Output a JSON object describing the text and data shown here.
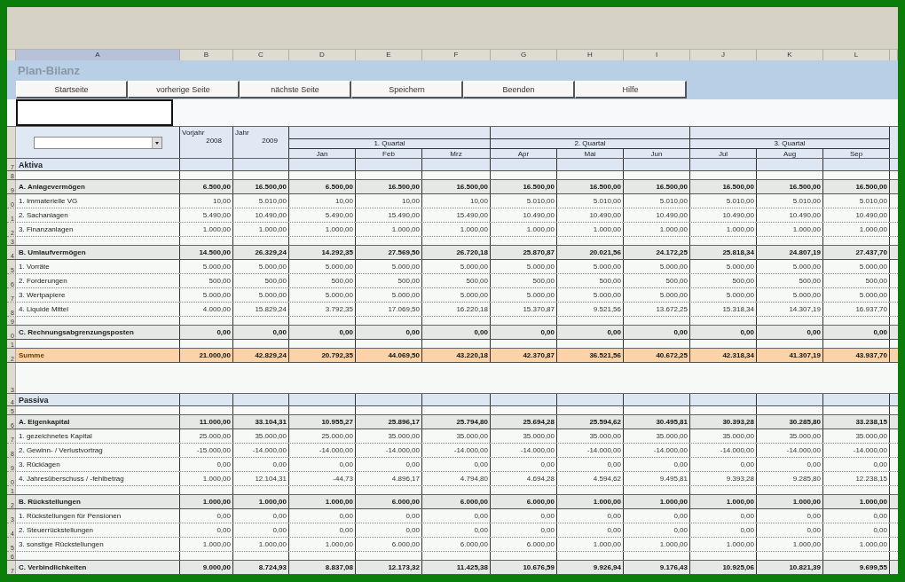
{
  "column_letters": [
    "A",
    "B",
    "C",
    "D",
    "E",
    "F",
    "G",
    "H",
    "I",
    "J",
    "K",
    "L"
  ],
  "title": "Plan-Bilanz",
  "buttons": [
    "Startseite",
    "vorherige Seite",
    "nächste Seite",
    "Speichern",
    "Beenden",
    "Hilfe"
  ],
  "header": {
    "prev_year_label": "Vorjahr",
    "prev_year": "2008",
    "year_label": "Jahr",
    "year": "2009",
    "quarters": [
      "1. Quartal",
      "2. Quartal",
      "3. Quartal"
    ],
    "months": [
      "Jan",
      "Feb",
      "Mrz",
      "Apr",
      "Mai",
      "Jun",
      "Jul",
      "Aug",
      "Sep"
    ]
  },
  "rows": [
    {
      "kind": "section",
      "row_number": "7",
      "label": "Aktiva"
    },
    {
      "kind": "blank",
      "row_number": "8"
    },
    {
      "kind": "group",
      "row_number": "9",
      "label": "A. Anlagevermögen",
      "values": [
        "6.500,00",
        "16.500,00",
        "6.500,00",
        "16.500,00",
        "16.500,00",
        "16.500,00",
        "16.500,00",
        "16.500,00",
        "16.500,00",
        "16.500,00",
        "16.500,00"
      ]
    },
    {
      "kind": "item",
      "row_number": "0",
      "label": "1. Immaterielle VG",
      "values": [
        "10,00",
        "5.010,00",
        "10,00",
        "10,00",
        "10,00",
        "5.010,00",
        "5.010,00",
        "5.010,00",
        "5.010,00",
        "5.010,00",
        "5.010,00"
      ]
    },
    {
      "kind": "item",
      "row_number": "1",
      "label": "2. Sachanlagen",
      "values": [
        "5.490,00",
        "10.490,00",
        "5.490,00",
        "15.490,00",
        "15.490,00",
        "10.490,00",
        "10.490,00",
        "10.490,00",
        "10.490,00",
        "10.490,00",
        "10.490,00"
      ]
    },
    {
      "kind": "item",
      "row_number": "2",
      "label": "3. Finanzanlagen",
      "values": [
        "1.000,00",
        "1.000,00",
        "1.000,00",
        "1.000,00",
        "1.000,00",
        "1.000,00",
        "1.000,00",
        "1.000,00",
        "1.000,00",
        "1.000,00",
        "1.000,00"
      ]
    },
    {
      "kind": "blank",
      "row_number": "3"
    },
    {
      "kind": "group",
      "row_number": "4",
      "label": "B. Umlaufvermögen",
      "values": [
        "14.500,00",
        "26.329,24",
        "14.292,35",
        "27.569,50",
        "26.720,18",
        "25.870,87",
        "20.021,56",
        "24.172,25",
        "25.818,34",
        "24.807,19",
        "27.437,70"
      ]
    },
    {
      "kind": "item",
      "row_number": "5",
      "label": "1. Vorräte",
      "values": [
        "5.000,00",
        "5.000,00",
        "5.000,00",
        "5.000,00",
        "5.000,00",
        "5.000,00",
        "5.000,00",
        "5.000,00",
        "5.000,00",
        "5.000,00",
        "5.000,00"
      ]
    },
    {
      "kind": "item",
      "row_number": "6",
      "label": "2. Forderungen",
      "values": [
        "500,00",
        "500,00",
        "500,00",
        "500,00",
        "500,00",
        "500,00",
        "500,00",
        "500,00",
        "500,00",
        "500,00",
        "500,00"
      ]
    },
    {
      "kind": "item",
      "row_number": "7",
      "label": "3. Wertpapiere",
      "values": [
        "5.000,00",
        "5.000,00",
        "5.000,00",
        "5.000,00",
        "5.000,00",
        "5.000,00",
        "5.000,00",
        "5.000,00",
        "5.000,00",
        "5.000,00",
        "5.000,00"
      ]
    },
    {
      "kind": "item",
      "row_number": "8",
      "label": "4. Liquide Mittel",
      "values": [
        "4.000,00",
        "15.829,24",
        "3.792,35",
        "17.069,50",
        "16.220,18",
        "15.370,87",
        "9.521,56",
        "13.672,25",
        "15.318,34",
        "14.307,19",
        "16.937,70"
      ]
    },
    {
      "kind": "blank",
      "row_number": "9"
    },
    {
      "kind": "group",
      "row_number": "0",
      "label": "C. Rechnungsabgrenzungsposten",
      "values": [
        "0,00",
        "0,00",
        "0,00",
        "0,00",
        "0,00",
        "0,00",
        "0,00",
        "0,00",
        "0,00",
        "0,00",
        "0,00"
      ]
    },
    {
      "kind": "blank",
      "row_number": "1"
    },
    {
      "kind": "total",
      "row_number": "2",
      "label": "Summe",
      "values": [
        "21.000,00",
        "42.829,24",
        "20.792,35",
        "44.069,50",
        "43.220,18",
        "42.370,87",
        "36.521,56",
        "40.672,25",
        "42.318,34",
        "41.307,19",
        "43.937,70"
      ]
    },
    {
      "kind": "spacer",
      "row_number": "3"
    },
    {
      "kind": "section",
      "row_number": "4",
      "label": "Passiva"
    },
    {
      "kind": "blank",
      "row_number": "5"
    },
    {
      "kind": "group",
      "row_number": "6",
      "label": "A. Eigenkapital",
      "values": [
        "11.000,00",
        "33.104,31",
        "10.955,27",
        "25.896,17",
        "25.794,80",
        "25.694,28",
        "25.594,62",
        "30.495,81",
        "30.393,28",
        "30.285,80",
        "33.238,15"
      ]
    },
    {
      "kind": "item",
      "row_number": "7",
      "label": "1. gezeichnetes Kapital",
      "values": [
        "25.000,00",
        "35.000,00",
        "25.000,00",
        "35.000,00",
        "35.000,00",
        "35.000,00",
        "35.000,00",
        "35.000,00",
        "35.000,00",
        "35.000,00",
        "35.000,00"
      ]
    },
    {
      "kind": "item",
      "row_number": "8",
      "label": "2. Gewinn- / Verlustvortrag",
      "values": [
        "-15.000,00",
        "-14.000,00",
        "-14.000,00",
        "-14.000,00",
        "-14.000,00",
        "-14.000,00",
        "-14.000,00",
        "-14.000,00",
        "-14.000,00",
        "-14.000,00",
        "-14.000,00"
      ]
    },
    {
      "kind": "item",
      "row_number": "9",
      "label": "3. Rücklagen",
      "values": [
        "0,00",
        "0,00",
        "0,00",
        "0,00",
        "0,00",
        "0,00",
        "0,00",
        "0,00",
        "0,00",
        "0,00",
        "0,00"
      ]
    },
    {
      "kind": "item",
      "row_number": "0",
      "label": "4. Jahresüberschuss / -fehlbetrag",
      "values": [
        "1.000,00",
        "12.104,31",
        "-44,73",
        "4.896,17",
        "4.794,80",
        "4.694,28",
        "4.594,62",
        "9.495,81",
        "9.393,28",
        "9.285,80",
        "12.238,15"
      ]
    },
    {
      "kind": "blank",
      "row_number": "1"
    },
    {
      "kind": "group",
      "row_number": "2",
      "label": "B. Rückstellungen",
      "values": [
        "1.000,00",
        "1.000,00",
        "1.000,00",
        "6.000,00",
        "6.000,00",
        "6.000,00",
        "1.000,00",
        "1.000,00",
        "1.000,00",
        "1.000,00",
        "1.000,00"
      ]
    },
    {
      "kind": "item",
      "row_number": "3",
      "label": "1. Rückstellungen für Pensionen",
      "values": [
        "0,00",
        "0,00",
        "0,00",
        "0,00",
        "0,00",
        "0,00",
        "0,00",
        "0,00",
        "0,00",
        "0,00",
        "0,00"
      ]
    },
    {
      "kind": "item",
      "row_number": "4",
      "label": "2. Steuerrückstellungen",
      "values": [
        "0,00",
        "0,00",
        "0,00",
        "0,00",
        "0,00",
        "0,00",
        "0,00",
        "0,00",
        "0,00",
        "0,00",
        "0,00"
      ]
    },
    {
      "kind": "item",
      "row_number": "5",
      "label": "3. sonstige Rückstellungen",
      "values": [
        "1.000,00",
        "1.000,00",
        "1.000,00",
        "6.000,00",
        "6.000,00",
        "6.000,00",
        "1.000,00",
        "1.000,00",
        "1.000,00",
        "1.000,00",
        "1.000,00"
      ]
    },
    {
      "kind": "blank",
      "row_number": "6"
    },
    {
      "kind": "group",
      "row_number": "7",
      "label": "C. Verbindlichkeiten",
      "values": [
        "9.000,00",
        "8.724,93",
        "8.837,08",
        "12.173,32",
        "11.425,38",
        "10.676,59",
        "9.926,94",
        "9.176,43",
        "10.925,06",
        "10.821,39",
        "9.699,55"
      ]
    }
  ]
}
